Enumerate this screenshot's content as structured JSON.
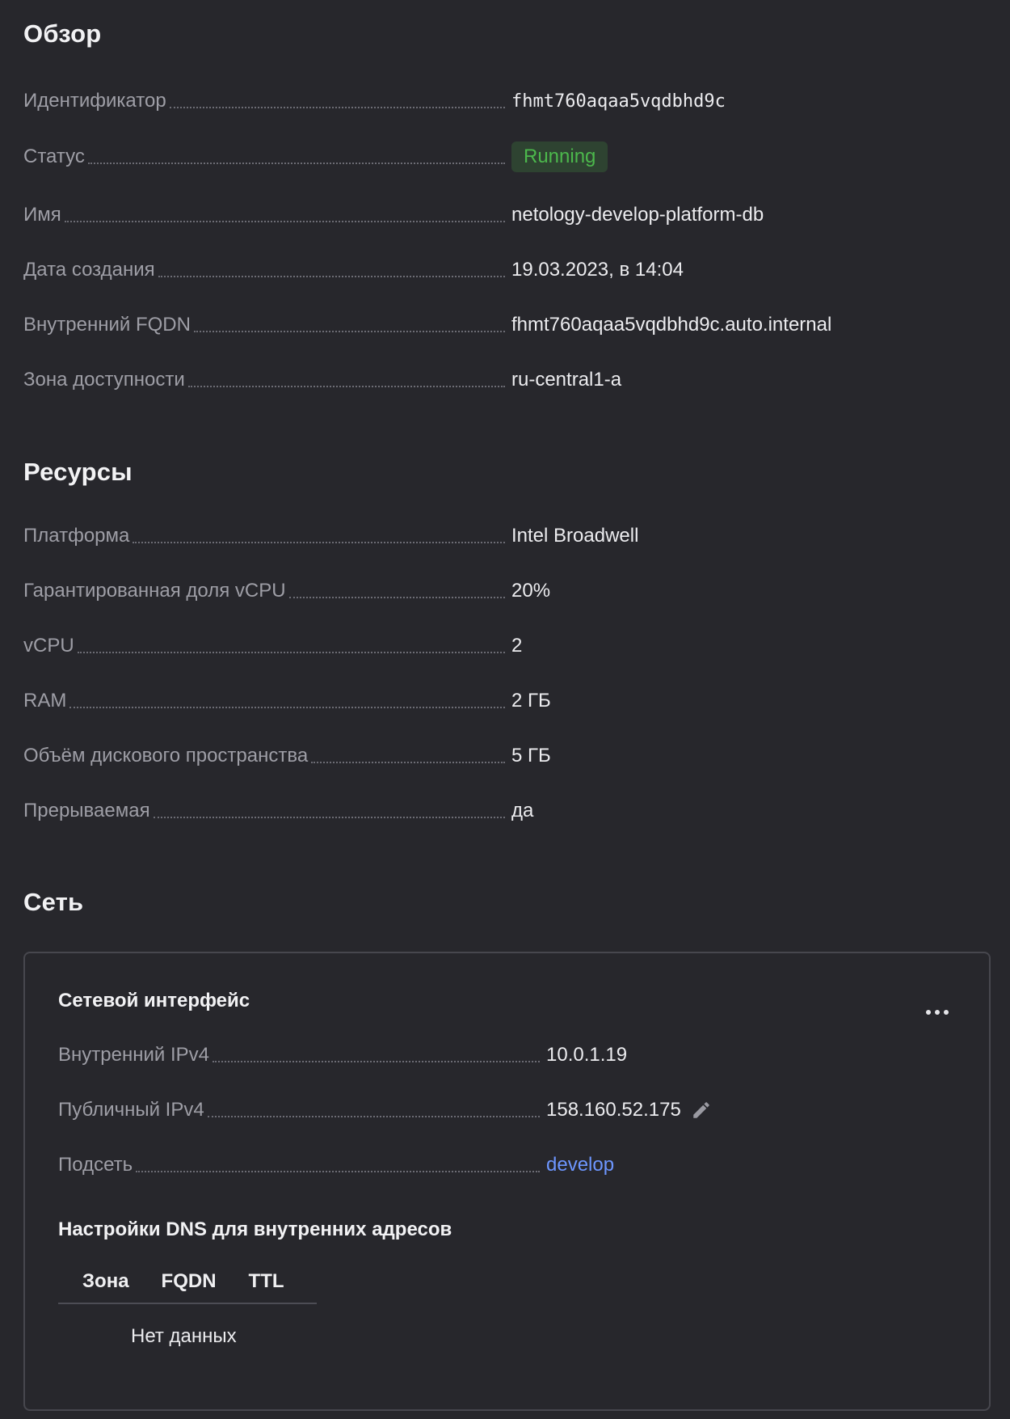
{
  "overview": {
    "title": "Обзор",
    "fields": [
      {
        "label": "Идентификатор",
        "value": "fhmt760aqaa5vqdbhd9c"
      },
      {
        "label": "Статус",
        "value": "Running"
      },
      {
        "label": "Имя",
        "value": "netology-develop-platform-db"
      },
      {
        "label": "Дата создания",
        "value": "19.03.2023, в 14:04"
      },
      {
        "label": "Внутренний FQDN",
        "value": "fhmt760aqaa5vqdbhd9c.auto.internal"
      },
      {
        "label": "Зона доступности",
        "value": "ru-central1-a"
      }
    ]
  },
  "resources": {
    "title": "Ресурсы",
    "fields": [
      {
        "label": "Платформа",
        "value": "Intel Broadwell"
      },
      {
        "label": "Гарантированная доля vCPU",
        "value": "20%"
      },
      {
        "label": "vCPU",
        "value": "2"
      },
      {
        "label": "RAM",
        "value": "2 ГБ"
      },
      {
        "label": "Объём дискового пространства",
        "value": "5 ГБ"
      },
      {
        "label": "Прерываемая",
        "value": "да"
      }
    ]
  },
  "network": {
    "title": "Сеть",
    "interface": {
      "title": "Сетевой интерфейс",
      "fields": [
        {
          "label": "Внутренний IPv4",
          "value": "10.0.1.19"
        },
        {
          "label": "Публичный IPv4",
          "value": "158.160.52.175"
        },
        {
          "label": "Подсеть",
          "value": "develop"
        }
      ]
    },
    "dns": {
      "title": "Настройки DNS для внутренних адресов",
      "columns": [
        "Зона",
        "FQDN",
        "TTL"
      ],
      "empty_text": "Нет данных"
    }
  },
  "colors": {
    "background": "#27272c",
    "status_running": "#4cb84c",
    "link": "#6d96ff"
  }
}
